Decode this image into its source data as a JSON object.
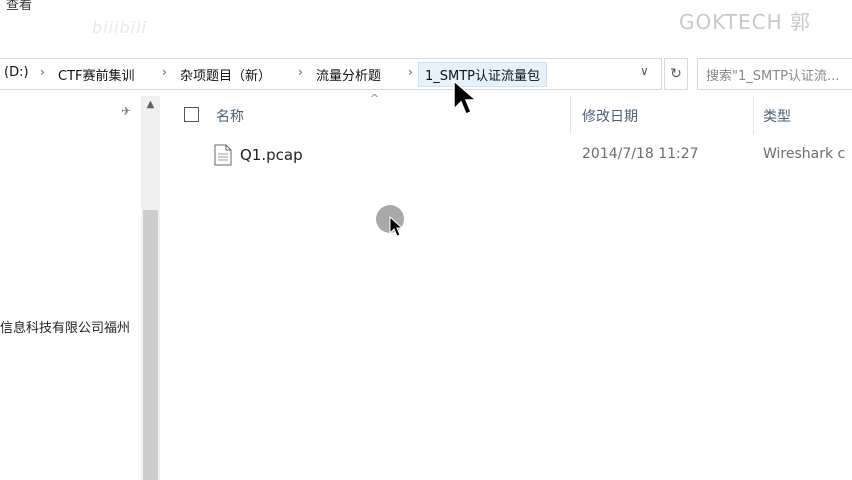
{
  "ribbon": {
    "view_label": "查看",
    "logo_text": "bilibili"
  },
  "watermark": "GOKTECH  郭",
  "address": {
    "crumbs": [
      "(D:)",
      "CTF赛前集训",
      "杂项题目（新）",
      "流量分析题",
      "1_SMTP认证流量包"
    ],
    "separator": "›",
    "dropdown_glyph": "∨",
    "refresh_glyph": "↻"
  },
  "search": {
    "placeholder": "搜索\"1_SMTP认证流..."
  },
  "nav": {
    "partial_text": "信息科技有限公司福州",
    "pin_glyph": "✈"
  },
  "columns": {
    "name": "名称",
    "date": "修改日期",
    "type": "类型"
  },
  "files": [
    {
      "name": "Q1.pcap",
      "modified": "2014/7/18 11:27",
      "type": "Wireshark c"
    }
  ],
  "icons": {
    "file": "pcap-file-icon",
    "pin": "pin-icon",
    "refresh": "refresh-icon",
    "dropdown": "chevron-down-icon",
    "cursor": "mouse-pointer-icon",
    "busy": "busy-indicator-icon"
  }
}
